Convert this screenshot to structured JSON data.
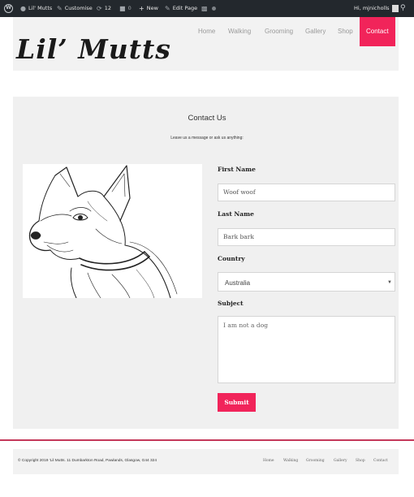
{
  "admin_bar": {
    "site_name": "Lil' Mutts",
    "customise": "Customise",
    "updates_count": "12",
    "comments_count": "0",
    "new": "New",
    "edit_page": "Edit Page",
    "greeting": "Hi, mjnicholls"
  },
  "header": {
    "logo": "Lil’ Mutts",
    "nav": [
      "Home",
      "Walking",
      "Grooming",
      "Gallery",
      "Shop",
      "Contact"
    ],
    "active_nav": "Contact"
  },
  "contact": {
    "title": "Contact Us",
    "subtitle": "Leave us a message or ask us anything:",
    "first_name_label": "First Name",
    "first_name_value": "Woof woof",
    "last_name_label": "Last Name",
    "last_name_value": "Bark bark",
    "country_label": "Country",
    "country_value": "Australia",
    "subject_label": "Subject",
    "subject_value": "I am not a dog",
    "submit": "Submit"
  },
  "footer": {
    "copyright": "© Copyright 2019 'Lil Mutts. 11 Dumbarkton Road, Pawlands, Glasgow, G44 324",
    "nav": [
      "Home",
      "Walking",
      "Grooming",
      "Gallery",
      "Shop",
      "Contact"
    ]
  },
  "colors": {
    "accent": "#f1245a",
    "admin_bar": "#23282d",
    "panel": "#f0f0f0"
  }
}
